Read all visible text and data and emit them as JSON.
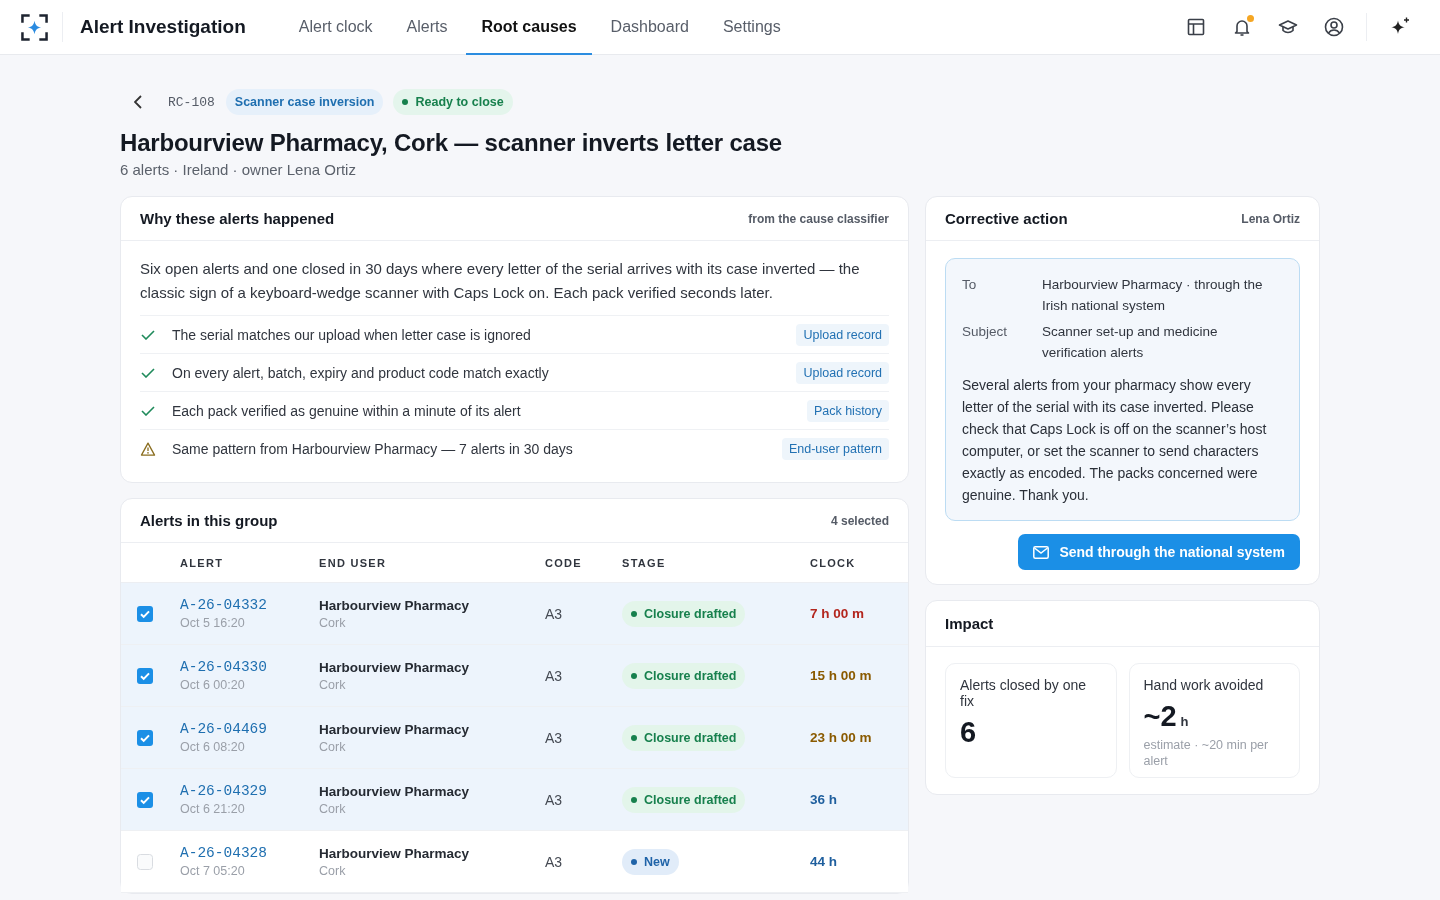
{
  "app": {
    "title": "Alert Investigation"
  },
  "nav": [
    {
      "label": "Alert clock",
      "selected": false
    },
    {
      "label": "Alerts",
      "selected": false
    },
    {
      "label": "Root causes",
      "selected": true
    },
    {
      "label": "Dashboard",
      "selected": false
    },
    {
      "label": "Settings",
      "selected": false
    }
  ],
  "toolbar": {
    "unread_notifications": true
  },
  "case": {
    "id": "RC-108",
    "category": "Scanner case inversion",
    "status": {
      "label": "Ready to close",
      "kind": "ready"
    },
    "title": "Harbourview Pharmacy, Cork — scanner inverts letter case",
    "meta": "6 alerts · Ireland · owner Lena Ortiz"
  },
  "why_panel": {
    "title": "Why these alerts happened",
    "source": "from the cause classifier",
    "summary": "Six open alerts and one closed in 30 days where every letter of the serial arrives with its case inverted — the classic sign of a keyboard-wedge scanner with Caps Lock on. Each pack verified seconds later.",
    "evidence": [
      {
        "kind": "check",
        "text": "The serial matches our upload when letter case is ignored",
        "link": "Upload record"
      },
      {
        "kind": "check",
        "text": "On every alert, batch, expiry and product code match exactly",
        "link": "Upload record"
      },
      {
        "kind": "check",
        "text": "Each pack verified as genuine within a minute of its alert",
        "link": "Pack history"
      },
      {
        "kind": "warning",
        "text": "Same pattern from Harbourview Pharmacy — 7 alerts in 30 days",
        "link": "End-user pattern"
      }
    ]
  },
  "alerts_panel": {
    "title": "Alerts in this group",
    "selection_count": "4 selected",
    "columns": [
      "ALERT",
      "END USER",
      "CODE",
      "STAGE",
      "CLOCK"
    ],
    "rows": [
      {
        "selected": true,
        "alert": "A-26-04332",
        "time": "Oct 5 16:20",
        "end_user": "Harbourview Pharmacy",
        "city": "Cork",
        "code": "A3",
        "stage": {
          "label": "Closure drafted",
          "kind": "drafted"
        },
        "clock": {
          "text": "7 h 00 m",
          "color": "#b3261e"
        }
      },
      {
        "selected": true,
        "alert": "A-26-04330",
        "time": "Oct 6 00:20",
        "end_user": "Harbourview Pharmacy",
        "city": "Cork",
        "code": "A3",
        "stage": {
          "label": "Closure drafted",
          "kind": "drafted"
        },
        "clock": {
          "text": "15 h 00 m",
          "color": "#8a5a00"
        }
      },
      {
        "selected": true,
        "alert": "A-26-04469",
        "time": "Oct 6 08:20",
        "end_user": "Harbourview Pharmacy",
        "city": "Cork",
        "code": "A3",
        "stage": {
          "label": "Closure drafted",
          "kind": "drafted"
        },
        "clock": {
          "text": "23 h 00 m",
          "color": "#8a5a00"
        }
      },
      {
        "selected": true,
        "alert": "A-26-04329",
        "time": "Oct 6 21:20",
        "end_user": "Harbourview Pharmacy",
        "city": "Cork",
        "code": "A3",
        "stage": {
          "label": "Closure drafted",
          "kind": "drafted"
        },
        "clock": {
          "text": "36 h",
          "color": "#1f5f9e"
        }
      },
      {
        "selected": false,
        "alert": "A-26-04328",
        "time": "Oct 7 05:20",
        "end_user": "Harbourview Pharmacy",
        "city": "Cork",
        "code": "A3",
        "stage": {
          "label": "New",
          "kind": "new"
        },
        "clock": {
          "text": "44 h",
          "color": "#1f5f9e"
        }
      }
    ]
  },
  "corrective_action": {
    "title": "Corrective action",
    "owner": "Lena Ortiz",
    "fields": [
      {
        "label": "To",
        "value": "Harbourview Pharmacy · through the Irish national system"
      },
      {
        "label": "Subject",
        "value": "Scanner set-up and medicine verification alerts"
      }
    ],
    "body": "Several alerts from your pharmacy show every letter of the serial with its case inverted. Please check that Caps Lock is off on the scanner’s host computer, or set the scanner to send characters exactly as encoded. The packs concerned were genuine. Thank you.",
    "send_button": "Send through the national system"
  },
  "impact": {
    "title": "Impact",
    "metrics": [
      {
        "label": "Alerts closed by one fix",
        "value": "6"
      },
      {
        "label": "Hand work avoided",
        "value": "~2",
        "unit": "h",
        "note": "estimate · ~20 min per alert"
      }
    ]
  }
}
